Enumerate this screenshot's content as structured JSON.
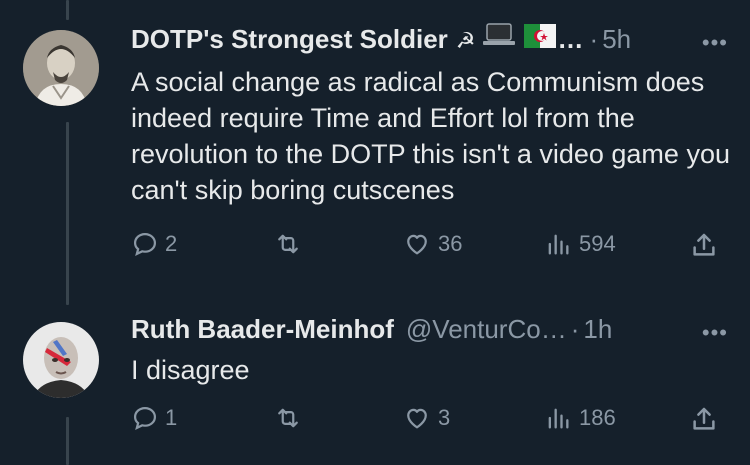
{
  "tweets": [
    {
      "name": "DOTP's Strongest Soldier",
      "name_suffix": "…",
      "handle": "",
      "dot": "·",
      "time": "5h",
      "more": "•••",
      "text": "A social change as radical as Communism does indeed require Time and Effort lol from the revolution to the DOTP this isn't a video game you can't skip boring cutscenes",
      "replies": "2",
      "retweets": "",
      "likes": "36",
      "views": "594"
    },
    {
      "name": "Ruth Baader-Meinhof",
      "handle": "@VenturCo…",
      "dot": "·",
      "time": "1h",
      "more": "•••",
      "text": "I disagree",
      "replies": "1",
      "retweets": "",
      "likes": "3",
      "views": "186"
    }
  ],
  "icons": {
    "reply": "speech-bubble-icon",
    "retweet": "retweet-arrows-icon",
    "like": "heart-icon",
    "views": "bar-chart-icon",
    "share": "share-upload-icon",
    "name_emoji": [
      "hammer-sickle-icon",
      "laptop-icon",
      "algeria-flag-icon"
    ]
  },
  "colors": {
    "background": "#15202b",
    "text": "#e7e9ea",
    "muted": "#8b98a5",
    "thread_line": "#38444d"
  }
}
